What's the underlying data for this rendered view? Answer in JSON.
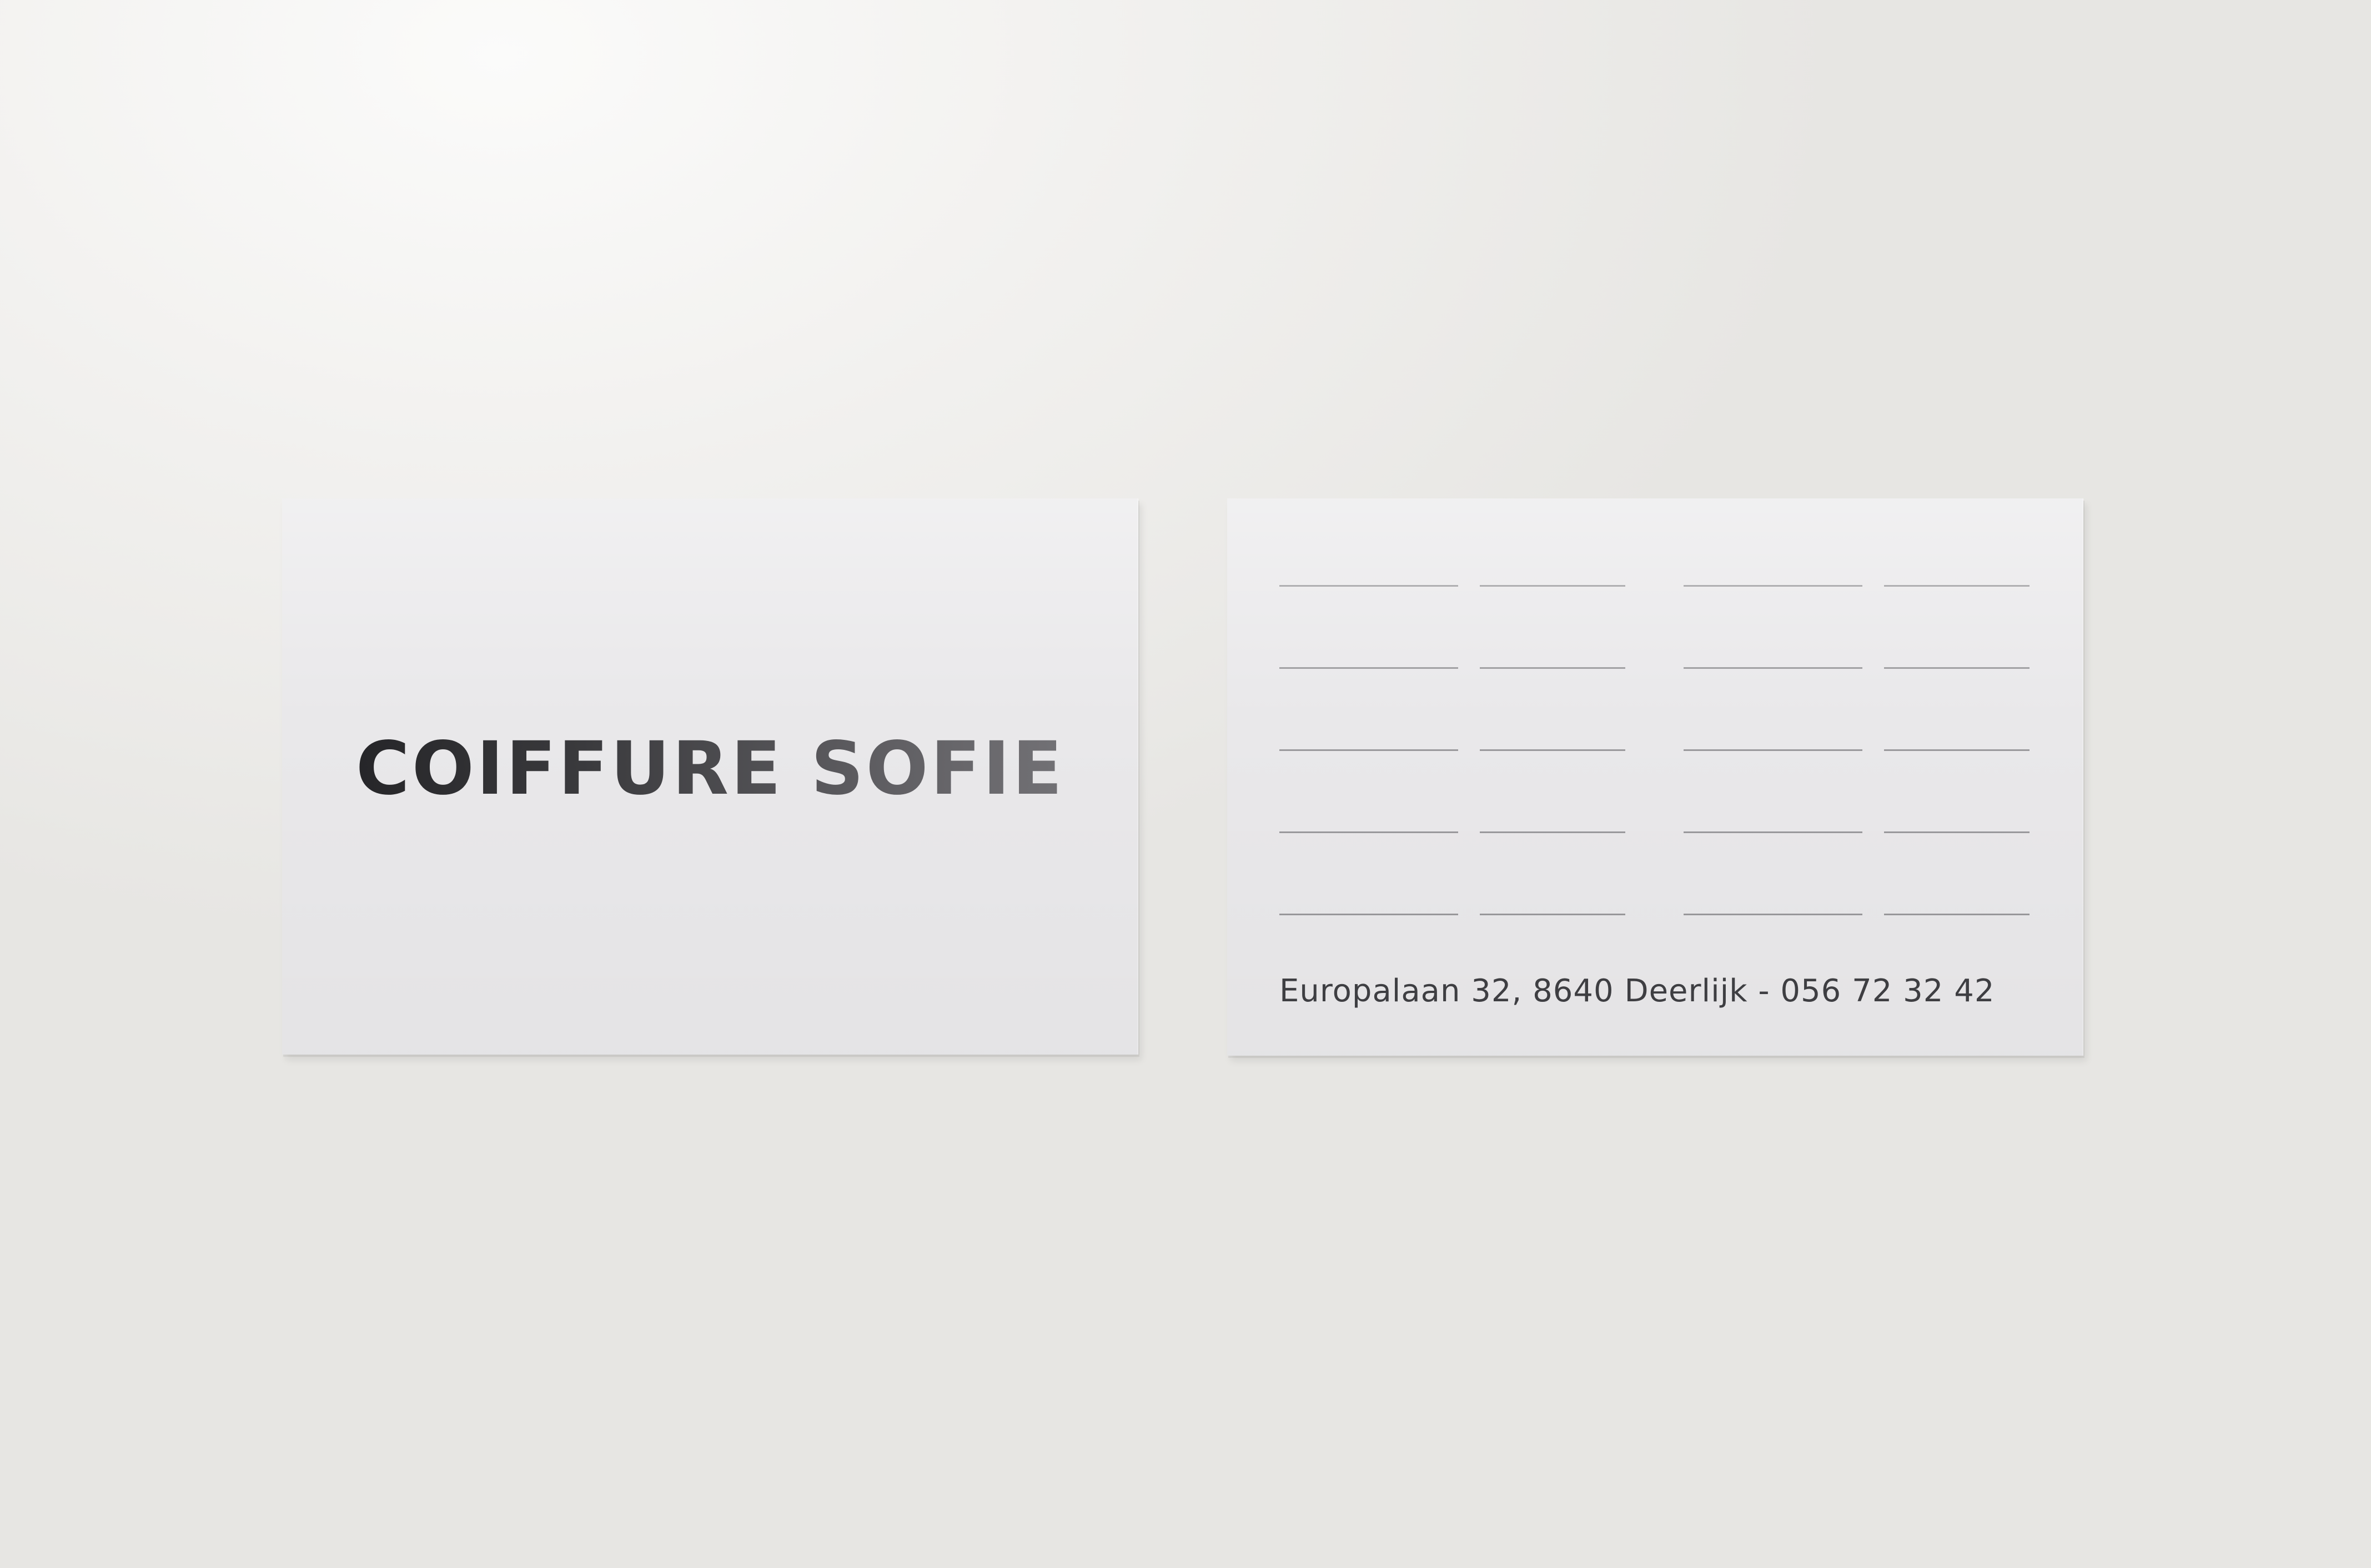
{
  "front_card": {
    "brand_name": "COIFFURE SOFIE"
  },
  "back_card": {
    "address_line": "Europalaan 32, 8640 Deerlijk - 056 72 32 42",
    "appointment_rows": 5,
    "appointment_columns": 4
  },
  "colors": {
    "background": "#f0efed",
    "card": "#e9e8ea",
    "text": "#2b2b2e",
    "lines": "#9a999c"
  }
}
